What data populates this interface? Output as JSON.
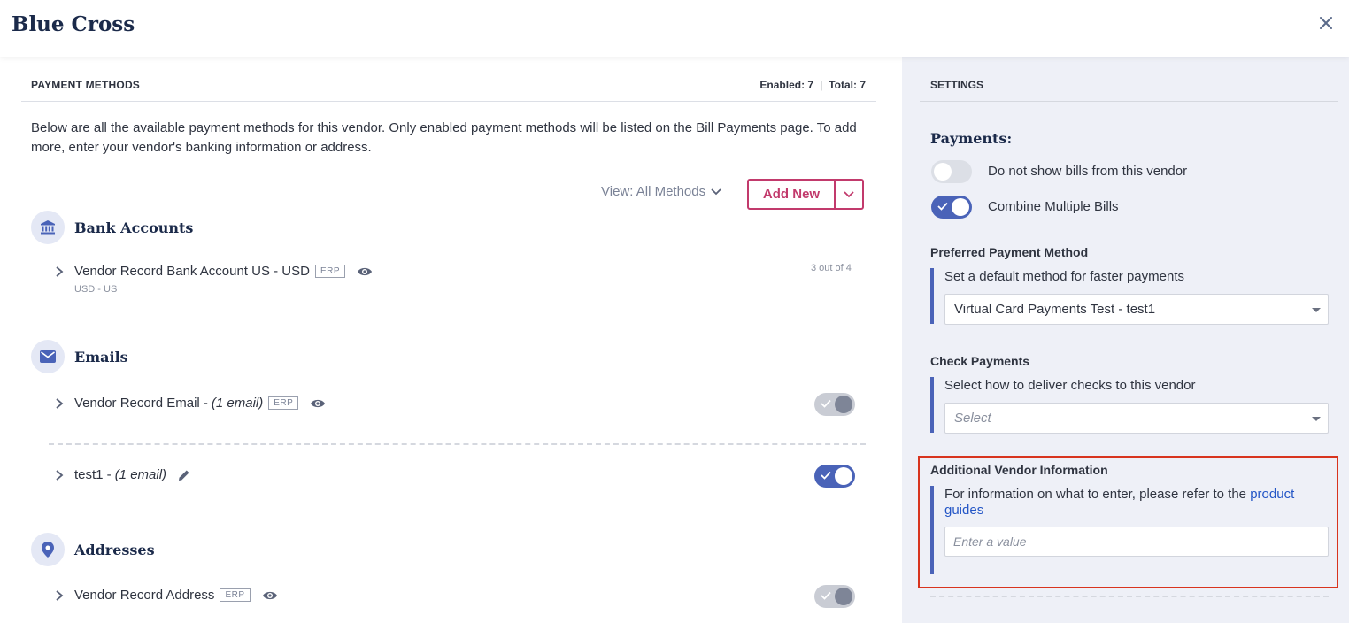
{
  "header": {
    "title": "Blue Cross"
  },
  "payment_methods": {
    "heading": "PAYMENT METHODS",
    "enabled": "Enabled: 7",
    "total": "Total: 7",
    "intro": "Below are all the available payment methods for this vendor. Only enabled payment methods will be listed on the Bill Payments page. To add more, enter your vendor's banking information or address.",
    "view_label": "View: All Methods",
    "add_new_label": "Add New",
    "bank_accounts": {
      "title": "Bank Accounts",
      "items": [
        {
          "name": "Vendor Record Bank Account US - USD",
          "badge": "ERP",
          "sub": "USD - US",
          "note": "3 out of 4"
        }
      ]
    },
    "emails": {
      "title": "Emails",
      "items": [
        {
          "name": "Vendor Record Email -",
          "detail": "(1 email)",
          "badge": "ERP",
          "enabled": true,
          "locked": true
        },
        {
          "name": "test1 -",
          "detail": "(1 email)",
          "enabled": true,
          "locked": false
        }
      ]
    },
    "addresses": {
      "title": "Addresses",
      "items": [
        {
          "name": "Vendor Record Address",
          "badge": "ERP",
          "enabled": true,
          "locked": true
        }
      ]
    }
  },
  "settings": {
    "heading": "SETTINGS",
    "payments_title": "Payments:",
    "options": [
      {
        "label": "Do not show bills from this vendor",
        "on": false
      },
      {
        "label": "Combine Multiple Bills",
        "on": true
      }
    ],
    "preferred": {
      "title": "Preferred Payment Method",
      "desc": "Set a default method for faster payments",
      "value": "Virtual Card Payments Test - test1"
    },
    "check": {
      "title": "Check Payments",
      "desc": "Select how to deliver checks to this vendor",
      "placeholder": "Select"
    },
    "additional": {
      "title": "Additional Vendor Information",
      "desc_prefix": "For information on what to enter, please refer to the",
      "link": "product guides",
      "placeholder": "Enter a value"
    }
  },
  "colors": {
    "accent": "#4a63b8",
    "brand_pink": "#c23a6c",
    "highlight": "#d8341e"
  }
}
